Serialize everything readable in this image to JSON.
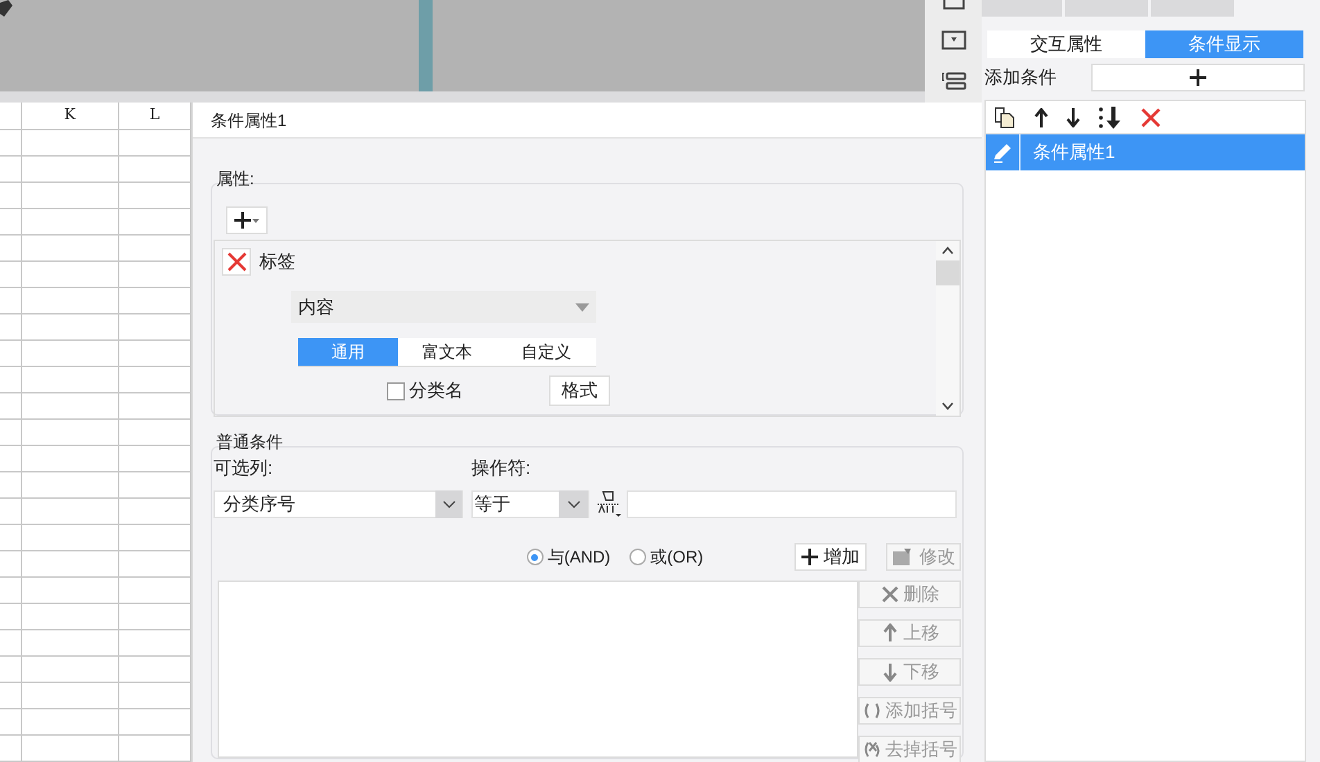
{
  "sheet": {
    "column_headers": [
      "K",
      "L"
    ]
  },
  "dialog": {
    "title": "条件属性1",
    "properties": {
      "legend": "属性:",
      "items": [
        {
          "label": "标签",
          "content_select": "内容",
          "format_tabs": [
            {
              "label": "通用",
              "selected": true
            },
            {
              "label": "富文本",
              "selected": false
            },
            {
              "label": "自定义",
              "selected": false
            }
          ],
          "category_name": {
            "label": "分类名",
            "checked": false
          },
          "format_button": "格式"
        }
      ]
    },
    "conditions": {
      "legend": "普通条件",
      "column_label": "可选列:",
      "column_value": "分类序号",
      "operator_label": "操作符:",
      "operator_value": "等于",
      "logic": [
        {
          "label": "与(AND)",
          "selected": true
        },
        {
          "label": "或(OR)",
          "selected": false
        }
      ],
      "add_button": {
        "label": "增加",
        "disabled": false
      },
      "modify_button": {
        "label": "修改",
        "disabled": true
      },
      "side_buttons": [
        {
          "kind": "delete",
          "label": "删除",
          "disabled": true
        },
        {
          "kind": "up",
          "label": "上移",
          "disabled": true
        },
        {
          "kind": "down",
          "label": "下移",
          "disabled": true
        },
        {
          "kind": "add-paren",
          "label": "添加括号",
          "disabled": true
        },
        {
          "kind": "remove-paren",
          "label": "去掉括号",
          "disabled": true
        }
      ]
    }
  },
  "right_panel": {
    "mode_tabs": [
      {
        "label": "交互属性",
        "selected": false
      },
      {
        "label": "条件显示",
        "selected": true
      }
    ],
    "add_condition_label": "添加条件",
    "condition_list": [
      {
        "label": "条件属性1",
        "selected": true
      }
    ]
  }
}
